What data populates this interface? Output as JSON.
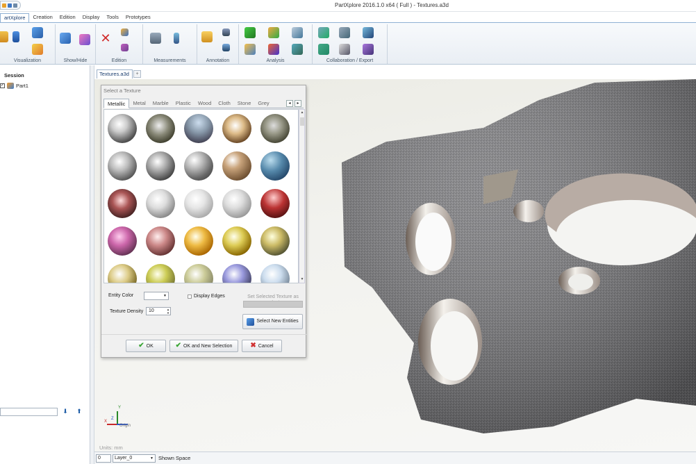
{
  "app": {
    "title": "PartXplore 2016.1.0 x64 ( Full ) - Textures.a3d"
  },
  "menu": {
    "items": [
      "artXplore",
      "Creation",
      "Edition",
      "Display",
      "Tools",
      "Prototypes"
    ]
  },
  "ribbon": {
    "groups": [
      "Visualization",
      "Show/Hide",
      "Edition",
      "Measurements",
      "Annotation",
      "Analysis",
      "Collaboration / Export"
    ]
  },
  "tree": {
    "header": "Session",
    "item": "Part1"
  },
  "document": {
    "tab": "Textures.a3d"
  },
  "viewport": {
    "units": "Units: mm",
    "triad_label": "Origin",
    "triad_axes": [
      "X",
      "Y",
      "Z"
    ]
  },
  "status": {
    "field1": "0",
    "layer": "Layer_0",
    "space": "Shown Space"
  },
  "dialog": {
    "title": "Select a Texture",
    "tabs": [
      "Metallic",
      "Metal",
      "Marble",
      "Plastic",
      "Wood",
      "Cloth",
      "Stone",
      "Grey"
    ],
    "active_tab": "Metallic",
    "entity_color_label": "Entity Color",
    "display_edges_label": "Display Edges",
    "display_edges_checked": false,
    "density_label": "Texture Density",
    "density_value": "10",
    "set_default_label": "Set Selected Texture as Default",
    "select_new_label": "Select New Entities",
    "ok_label": "OK",
    "ok_new_label": "OK and New Selection",
    "cancel_label": "Cancel"
  },
  "colors": {
    "ribbon_accent": "#8fb0d4",
    "viewport_bg": "#eeeeea",
    "part_gray": "#7a7a7d"
  }
}
